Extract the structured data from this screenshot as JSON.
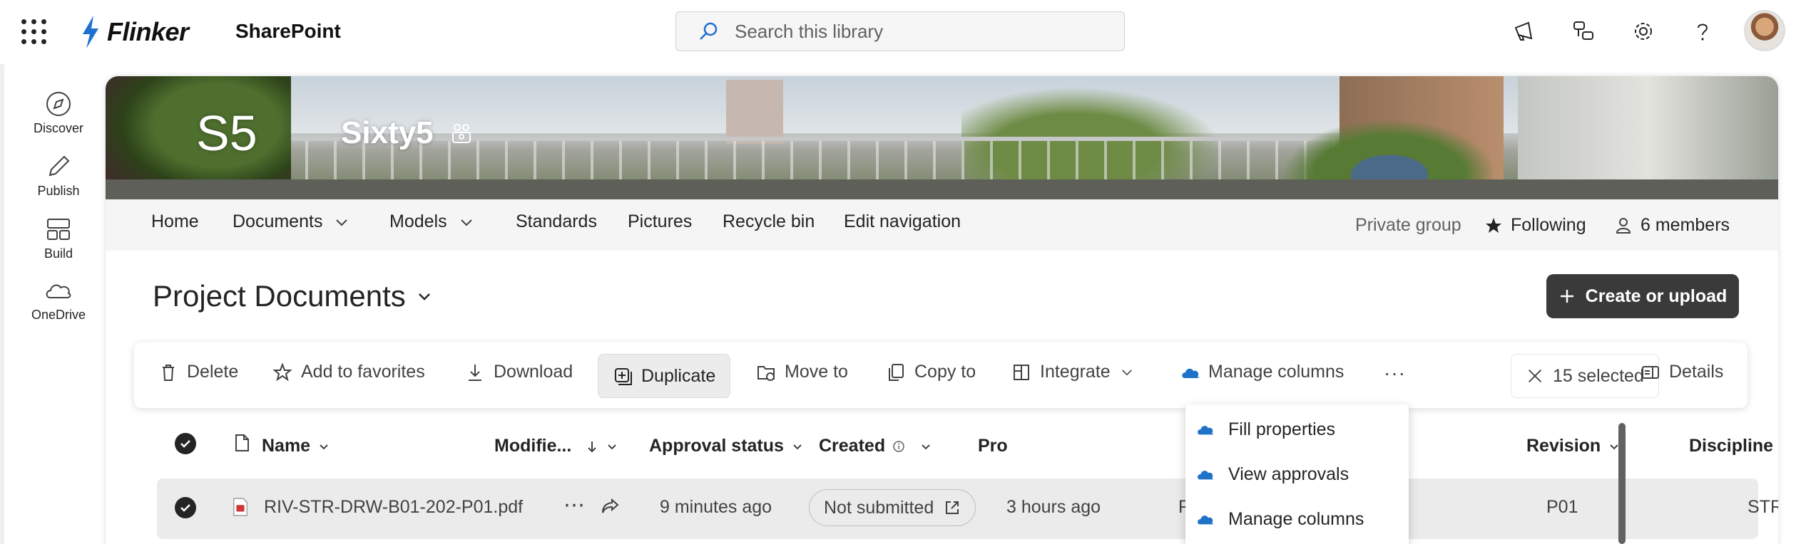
{
  "suitebar": {
    "brand": "Flinker",
    "app_name": "SharePoint",
    "search_placeholder": "Search this library"
  },
  "rail": {
    "items": [
      {
        "label": "Discover",
        "icon": "compass-icon"
      },
      {
        "label": "Publish",
        "icon": "pen-icon"
      },
      {
        "label": "Build",
        "icon": "layout-icon"
      },
      {
        "label": "OneDrive",
        "icon": "cloud-icon"
      }
    ]
  },
  "site": {
    "logo_text": "S5",
    "title": "Sixty5"
  },
  "sitenav": {
    "items": [
      {
        "label": "Home",
        "has_dropdown": false
      },
      {
        "label": "Documents",
        "has_dropdown": true
      },
      {
        "label": "Models",
        "has_dropdown": true
      },
      {
        "label": "Standards",
        "has_dropdown": false
      },
      {
        "label": "Pictures",
        "has_dropdown": false
      },
      {
        "label": "Recycle bin",
        "has_dropdown": false
      },
      {
        "label": "Edit navigation",
        "has_dropdown": false
      }
    ],
    "private_group": "Private group",
    "following": "Following",
    "members": "6 members"
  },
  "library": {
    "title": "Project Documents",
    "create_label": "Create or upload"
  },
  "commands": {
    "delete": "Delete",
    "favorites": "Add to favorites",
    "download": "Download",
    "duplicate": "Duplicate",
    "move": "Move to",
    "copy": "Copy to",
    "integrate": "Integrate",
    "manage_columns": "Manage columns",
    "more": "···",
    "selected": "15 selected",
    "details": "Details"
  },
  "list": {
    "headers": {
      "name": "Name",
      "modified": "Modifie...",
      "approval": "Approval status",
      "created": "Created",
      "project": "Pro",
      "revision": "Revision",
      "discipline": "Discipline"
    },
    "rows": [
      {
        "name": "RIV-STR-DRW-B01-202-P01.pdf",
        "modified": "9 minutes ago",
        "approval": "Not submitted",
        "created": "3 hours ago",
        "project": "RIV",
        "revision": "P01",
        "discipline": "STR"
      }
    ]
  },
  "menu": {
    "items": [
      "Fill properties",
      "View approvals",
      "Manage columns"
    ]
  },
  "colors": {
    "accent_dark": "#3a3a3a",
    "brand_blue": "#1f6fd1",
    "menu_icon_blue": "#1e72c8"
  }
}
